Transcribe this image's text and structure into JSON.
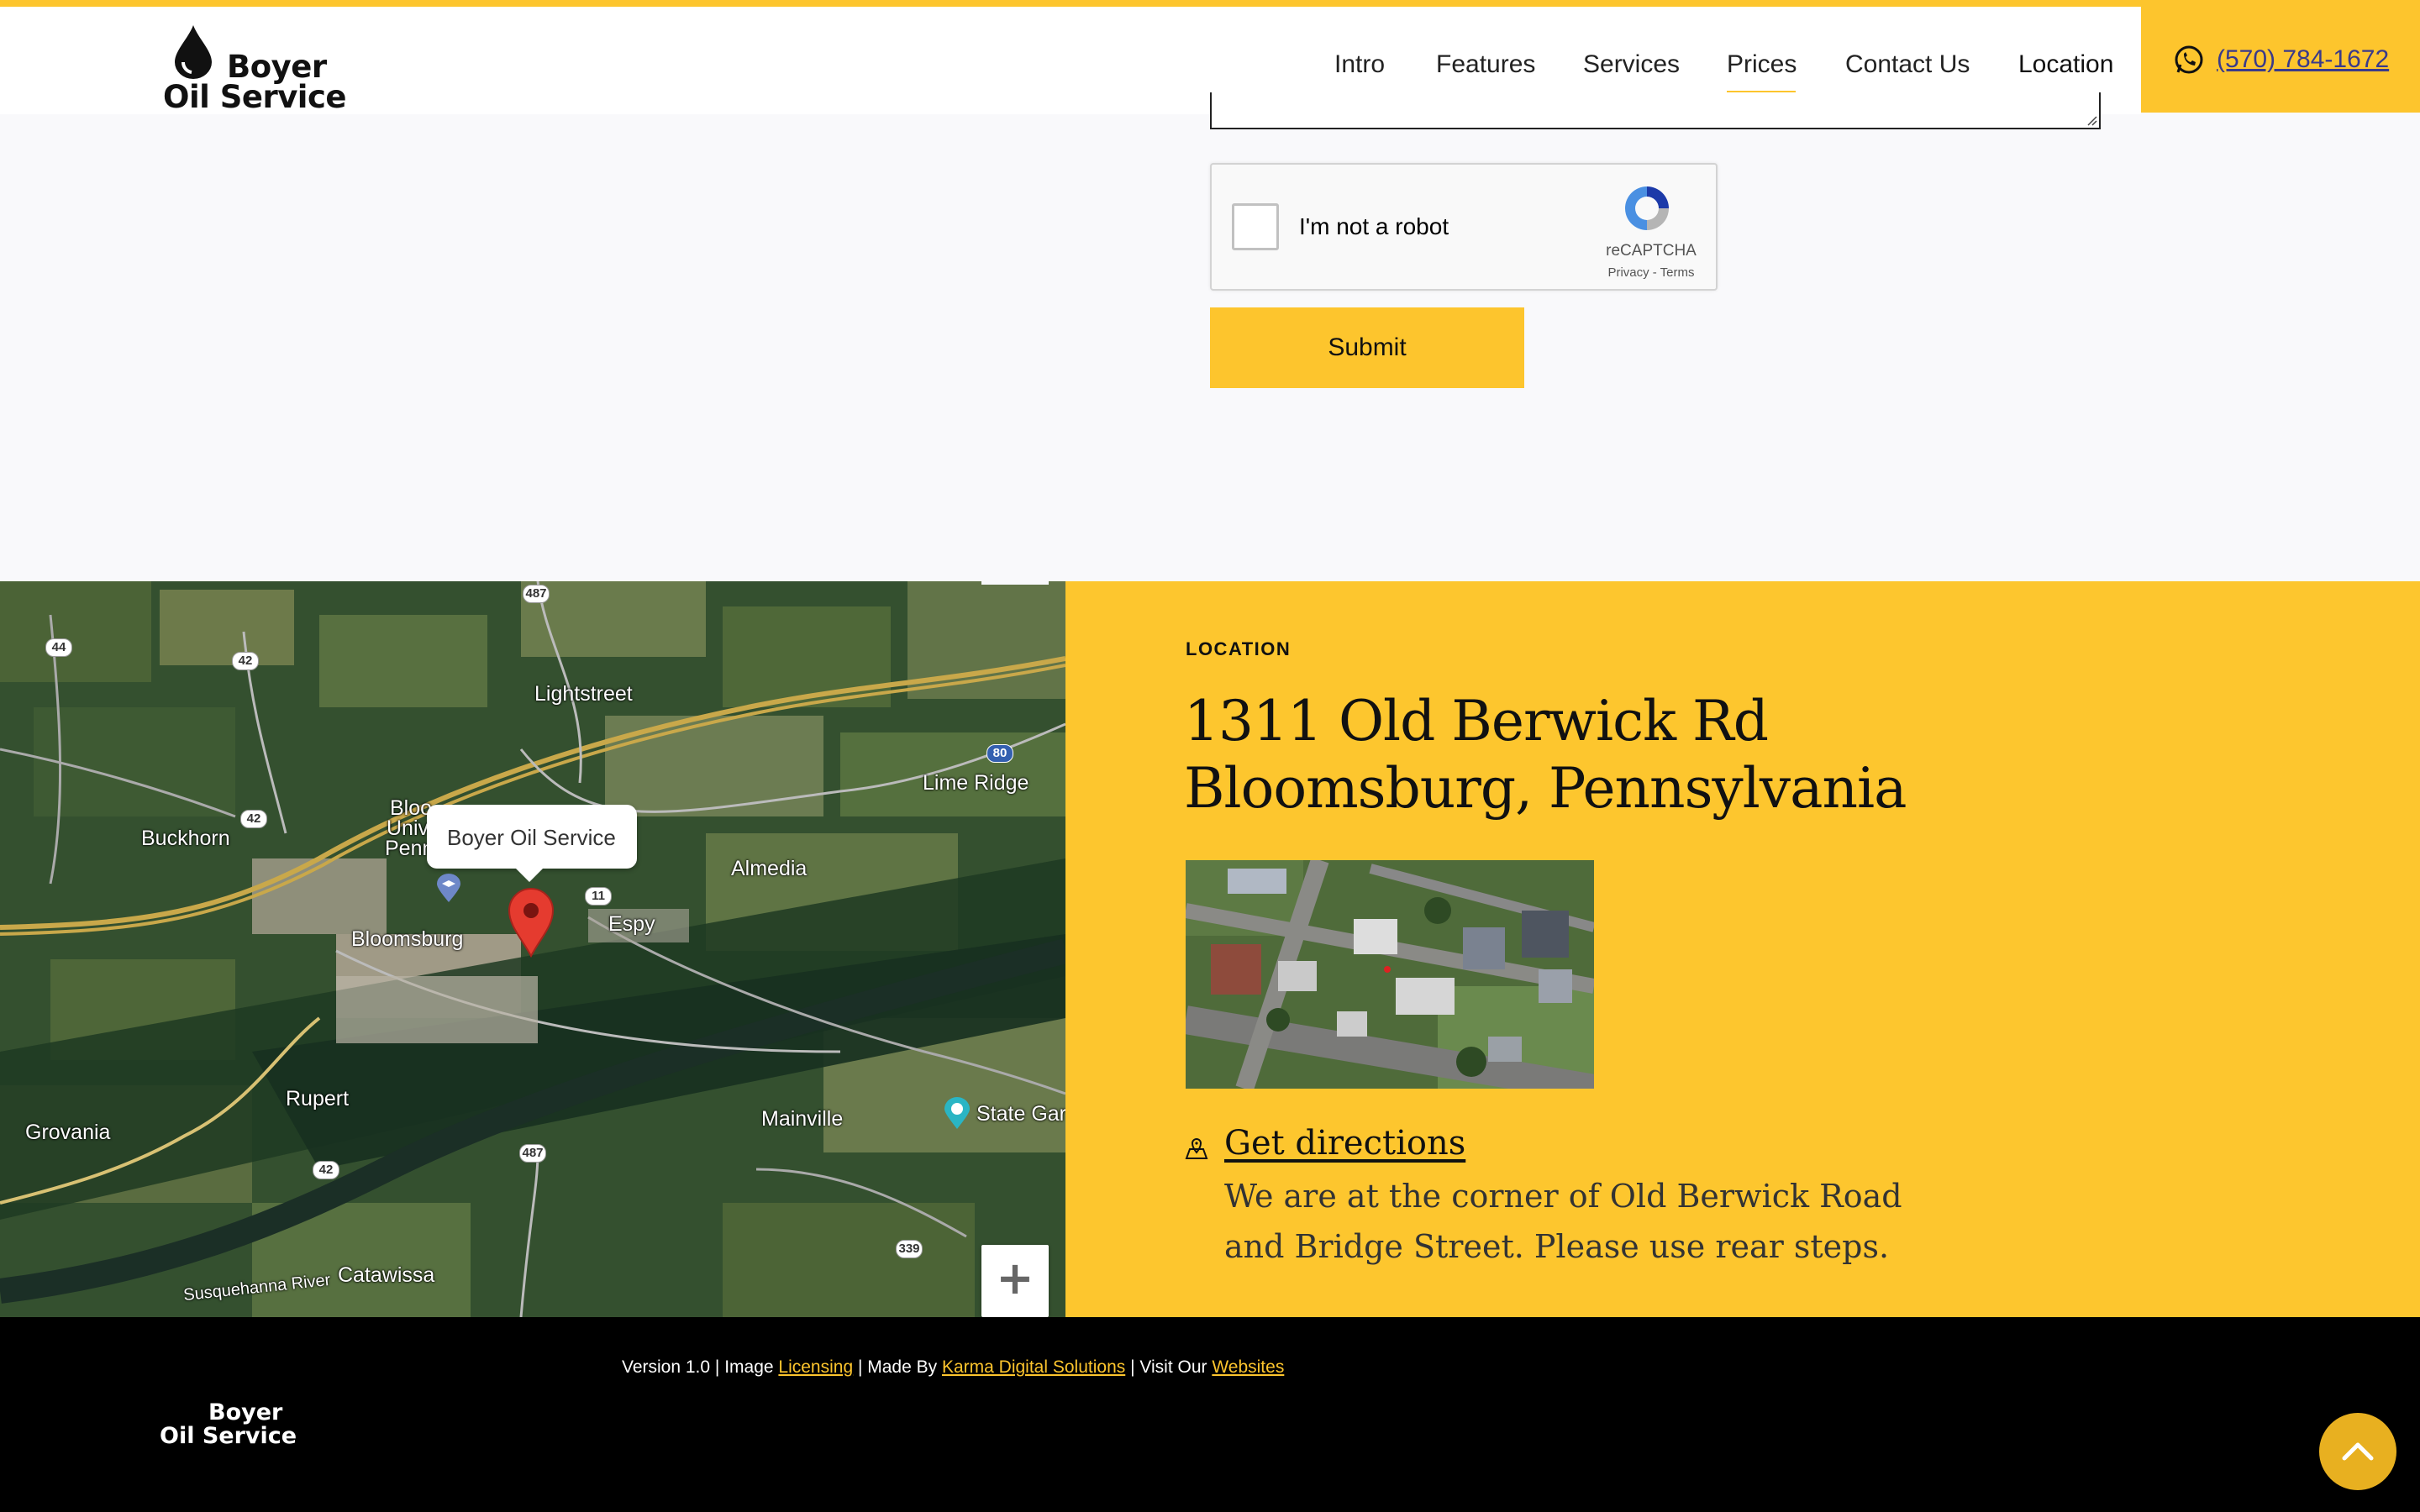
{
  "brand": {
    "line1": "Boyer",
    "line2": "Oil Service"
  },
  "nav": {
    "items": [
      {
        "label": "Intro"
      },
      {
        "label": "Features"
      },
      {
        "label": "Services"
      },
      {
        "label": "Prices"
      },
      {
        "label": "Contact Us"
      },
      {
        "label": "Location"
      }
    ],
    "phone": "(570) 784-1672"
  },
  "form": {
    "captcha_label": "I'm not a robot",
    "captcha_brand": "reCAPTCHA",
    "captcha_links": "Privacy - Terms",
    "submit_label": "Submit"
  },
  "map": {
    "marker_title": "Boyer Oil Service",
    "places": [
      "Lightstreet",
      "Lime Ridge",
      "Buckhorn",
      "Almedia",
      "Bloomsburg",
      "Espy",
      "Rupert",
      "Grovania",
      "Mainville",
      "State Gar",
      "Catawissa",
      "Susquehanna River",
      "Bloo",
      "Univ",
      "Penn"
    ],
    "shields": [
      "487",
      "44",
      "42",
      "42",
      "80",
      "11",
      "487",
      "42",
      "339"
    ]
  },
  "location": {
    "eyebrow": "LOCATION",
    "address_line1": "1311 Old Berwick Rd",
    "address_line2": "Bloomsburg, Pennsylvania",
    "directions_label": "Get directions",
    "directions_note": "We are at the corner of Old Berwick Road and Bridge Street. Please use rear steps."
  },
  "footer": {
    "version": "Version 1.0 |  Image ",
    "licensing": "Licensing",
    "made_by": "  |  Made By ",
    "karma": "Karma Digital Solutions",
    "visit": "  |  Visit Our ",
    "websites": "Websites"
  },
  "colors": {
    "accent": "#fdc52d",
    "footer_bg": "#000000"
  }
}
